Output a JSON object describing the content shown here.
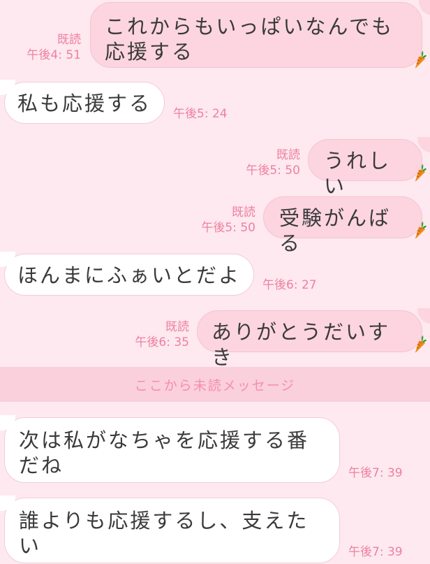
{
  "messages": [
    {
      "text": "これからもいっぱいなんでも\n応援する",
      "read": "既読",
      "time": "午後4: 51"
    },
    {
      "text": "私も応援する",
      "time": "午後5: 24"
    },
    {
      "text": "うれしい",
      "read": "既読",
      "time": "午後5: 50"
    },
    {
      "text": "受験がんばる",
      "read": "既読",
      "time": "午後5: 50"
    },
    {
      "text": "ほんまにふぁいとだよ",
      "time": "午後6: 27"
    },
    {
      "text": "ありがとうだいすき",
      "read": "既読",
      "time": "午後6: 35"
    },
    {
      "text": "次は私がなちゃを応援する番\nだね",
      "time": "午後7: 39"
    },
    {
      "text": "誰よりも応援するし、支えた\nい",
      "time": "午後7: 39"
    }
  ],
  "divider": {
    "label": "ここから未読メッセージ"
  },
  "icons": {
    "sticker": "carrot-icon"
  },
  "colors": {
    "background": "#fde9ef",
    "outgoing_bubble": "#fcd5e1",
    "incoming_bubble": "#ffffff",
    "meta_text": "#ef7fa1",
    "divider_bg": "#fad0dc"
  }
}
